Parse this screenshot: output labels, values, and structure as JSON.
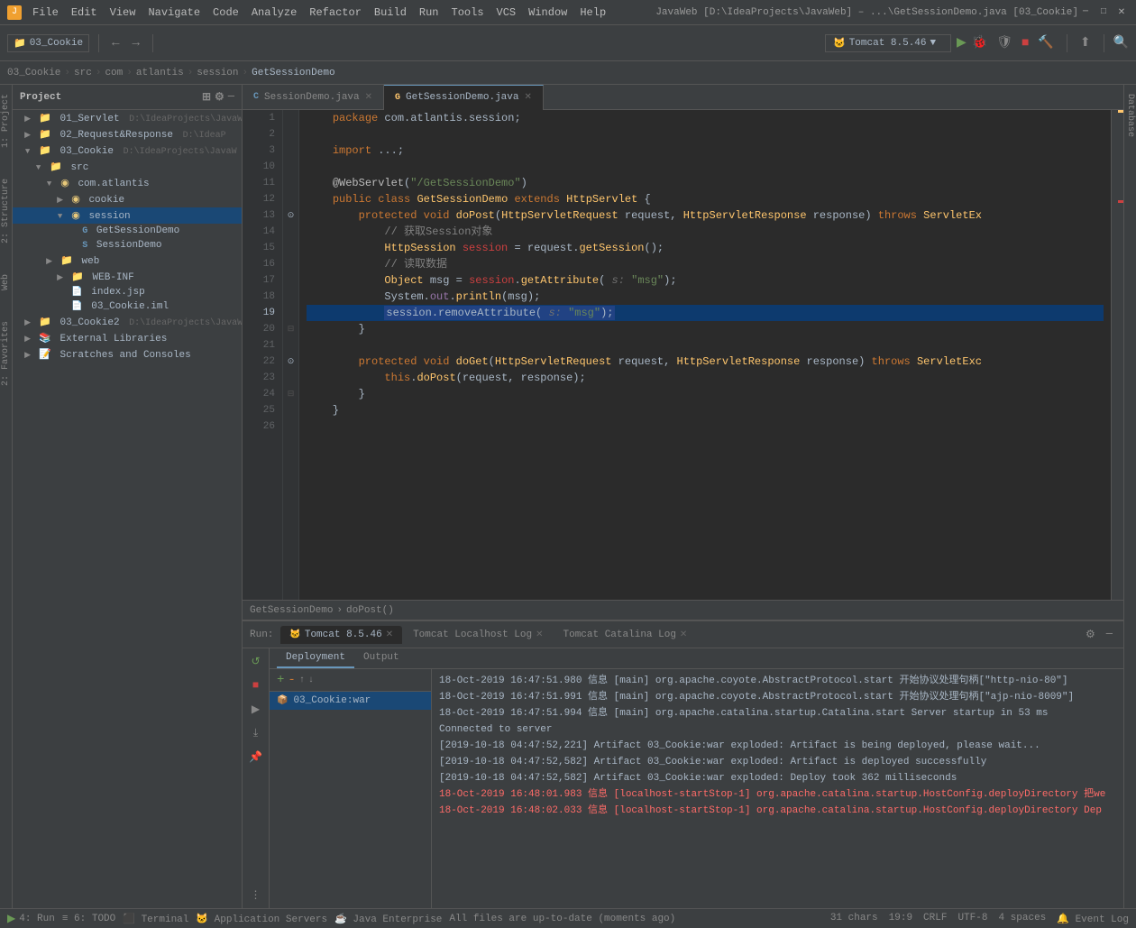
{
  "titlebar": {
    "title": "JavaWeb [D:\\IdeaProjects\\JavaWeb] – ...\\GetSessionDemo.java [03_Cookie]",
    "menus": [
      "File",
      "Edit",
      "View",
      "Navigate",
      "Code",
      "Analyze",
      "Refactor",
      "Build",
      "Run",
      "Tools",
      "VCS",
      "Window",
      "Help"
    ]
  },
  "breadcrumb": {
    "items": [
      "03_Cookie",
      "src",
      "com",
      "atlantis",
      "session",
      "GetSessionDemo"
    ]
  },
  "toolbar": {
    "run_config": "Tomcat 8.5.46",
    "version": "▼"
  },
  "project": {
    "title": "Project",
    "items": [
      {
        "id": "01_Servlet",
        "label": "01_Servlet",
        "path": "D:\\IdeaProjects\\JavaW",
        "indent": 1,
        "type": "folder",
        "open": true
      },
      {
        "id": "02_RequestResponse",
        "label": "02_Request&Response",
        "path": "D:\\IdeaP",
        "indent": 1,
        "type": "folder"
      },
      {
        "id": "03_Cookie",
        "label": "03_Cookie",
        "path": "D:\\IdeaProjects\\JavaW",
        "indent": 1,
        "type": "folder",
        "open": true
      },
      {
        "id": "src",
        "label": "src",
        "indent": 2,
        "type": "folder",
        "open": true
      },
      {
        "id": "com_atlantis",
        "label": "com.atlantis",
        "indent": 3,
        "type": "package",
        "open": true
      },
      {
        "id": "cookie",
        "label": "cookie",
        "indent": 4,
        "type": "package"
      },
      {
        "id": "session",
        "label": "session",
        "indent": 4,
        "type": "package",
        "open": true,
        "selected": true
      },
      {
        "id": "GetSessionDemo",
        "label": "GetSessionDemo",
        "indent": 5,
        "type": "java"
      },
      {
        "id": "SessionDemo",
        "label": "SessionDemo",
        "indent": 5,
        "type": "java"
      },
      {
        "id": "web",
        "label": "web",
        "indent": 3,
        "type": "folder"
      },
      {
        "id": "WEB-INF",
        "label": "WEB-INF",
        "indent": 4,
        "type": "folder"
      },
      {
        "id": "index_jsp",
        "label": "index.jsp",
        "indent": 4,
        "type": "jsp"
      },
      {
        "id": "03_Cookie_iml",
        "label": "03_Cookie.iml",
        "indent": 4,
        "type": "iml"
      },
      {
        "id": "03_Cookie2",
        "label": "03_Cookie2",
        "path": "D:\\IdeaProjects\\JavaW",
        "indent": 1,
        "type": "folder"
      },
      {
        "id": "External_Libraries",
        "label": "External Libraries",
        "indent": 1,
        "type": "lib"
      },
      {
        "id": "Scratches",
        "label": "Scratches and Consoles",
        "indent": 1,
        "type": "scratch"
      }
    ]
  },
  "editor": {
    "tabs": [
      {
        "label": "SessionDemo.java",
        "type": "java",
        "active": false
      },
      {
        "label": "GetSessionDemo.java",
        "type": "java-g",
        "active": true
      }
    ],
    "lines": [
      {
        "num": 1,
        "code": "    <span class='kw'>package</span> com.atlantis.session;"
      },
      {
        "num": 2,
        "code": ""
      },
      {
        "num": 3,
        "code": "    <span class='kw'>import</span> ...;"
      },
      {
        "num": 10,
        "code": ""
      },
      {
        "num": 11,
        "code": "    <span class='ann'>@WebServlet</span>(<span class='str'>\"/GetSessionDemo\"</span>)"
      },
      {
        "num": 12,
        "code": "    <span class='kw'>public</span> <span class='kw'>class</span> <span class='cls'>GetSessionDemo</span> <span class='kw'>extends</span> <span class='cls'>HttpServlet</span> {"
      },
      {
        "num": 13,
        "code": "        <span class='kw'>protected</span> <span class='kw'>void</span> <span class='meth'>doPost</span>(<span class='cls'>HttpServletRequest</span> request, <span class='cls'>HttpServletResponse</span> response) <span class='kw'>throws</span> <span class='cls'>ServletEx</span>"
      },
      {
        "num": 14,
        "code": "            <span class='cmt'>// 获取Session对象</span>"
      },
      {
        "num": 15,
        "code": "            <span class='cls'>HttpSession</span> <span class='var-red'>session</span> = request.<span class='meth'>getSession</span>();"
      },
      {
        "num": 16,
        "code": "            <span class='cmt'>// 读取数据</span>"
      },
      {
        "num": 17,
        "code": "            <span class='cls'>Object</span> msg = <span class='var-red'>session</span>.<span class='meth'>getAttribute</span>( <span class='str2'>s: </span><span class='str'>\"msg\"</span>);"
      },
      {
        "num": 18,
        "code": "            System.<span class='static-field'>out</span>.<span class='meth'>println</span>(msg);"
      },
      {
        "num": 19,
        "code": "            <span class='highlight-sel'>session.removeAttribute( <span class='str2'>s: </span><span class='str'>\"msg\"</span>);</span>"
      },
      {
        "num": 20,
        "code": "        }"
      },
      {
        "num": 21,
        "code": ""
      },
      {
        "num": 22,
        "code": "        <span class='kw'>protected</span> <span class='kw'>void</span> <span class='meth'>doGet</span>(<span class='cls'>HttpServletRequest</span> request, <span class='cls'>HttpServletResponse</span> response) <span class='kw'>throws</span> <span class='cls'>ServletExc</span>"
      },
      {
        "num": 23,
        "code": "            <span class='kw'>this</span>.<span class='meth'>doPost</span>(request, response);"
      },
      {
        "num": 24,
        "code": "        }"
      },
      {
        "num": 25,
        "code": "    }"
      },
      {
        "num": 26,
        "code": ""
      }
    ],
    "breadcrumb": "GetSessionDemo  >  doPost()"
  },
  "run_panel": {
    "run_label": "Run:",
    "tabs": [
      {
        "label": "Tomcat 8.5.46",
        "active": true
      },
      {
        "label": "Tomcat Localhost Log"
      },
      {
        "label": "Tomcat Catalina Log"
      }
    ],
    "sub_tabs": [
      {
        "label": "Deployment",
        "active": true
      },
      {
        "label": "Output"
      }
    ],
    "deployment": {
      "items": [
        {
          "label": "03_Cookie:war",
          "selected": true
        }
      ]
    },
    "log_lines": [
      {
        "text": "18-Oct-2019 16:47:51.980 信息 [main] org.apache.coyote.AbstractProtocol.start 开始协议处理句柄[\"http-nio-80\"]",
        "type": "info"
      },
      {
        "text": "18-Oct-2019 16:47:51.991 信息 [main] org.apache.coyote.AbstractProtocol.start 开始协议处理句柄[\"ajp-nio-8009\"]",
        "type": "info"
      },
      {
        "text": "18-Oct-2019 16:47:51.994 信息 [main] org.apache.catalina.startup.Catalina.start Server startup in 53 ms",
        "type": "info"
      },
      {
        "text": "Connected to server",
        "type": "green"
      },
      {
        "text": "[2019-10-18 04:47:52,221] Artifact 03_Cookie:war exploded: Artifact is being deployed, please wait...",
        "type": "info"
      },
      {
        "text": "[2019-10-18 04:47:52,582] Artifact 03_Cookie:war exploded: Artifact is deployed successfully",
        "type": "info"
      },
      {
        "text": "[2019-10-18 04:47:52,582] Artifact 03_Cookie:war exploded: Deploy took 362 milliseconds",
        "type": "info"
      },
      {
        "text": "18-Oct-2019 16:48:01.983 信息 [localhost-startStop-1] org.apache.catalina.startup.HostConfig.deployDirectory 把we",
        "type": "error"
      },
      {
        "text": "18-Oct-2019 16:48:02.033 信息 [localhost-startStop-1] org.apache.catalina.startup.HostConfig.deployDirectory Dep",
        "type": "error"
      }
    ]
  },
  "status_bar": {
    "left_items": [
      "4: Run",
      "6: TODO",
      "Terminal",
      "Application Servers",
      "Java Enterprise"
    ],
    "right_items": [
      "31 chars",
      "19:9",
      "CRLF",
      "UTF-8",
      "4 spaces"
    ],
    "message": "All files are up-to-date (moments ago)",
    "event_log": "Event Log"
  }
}
